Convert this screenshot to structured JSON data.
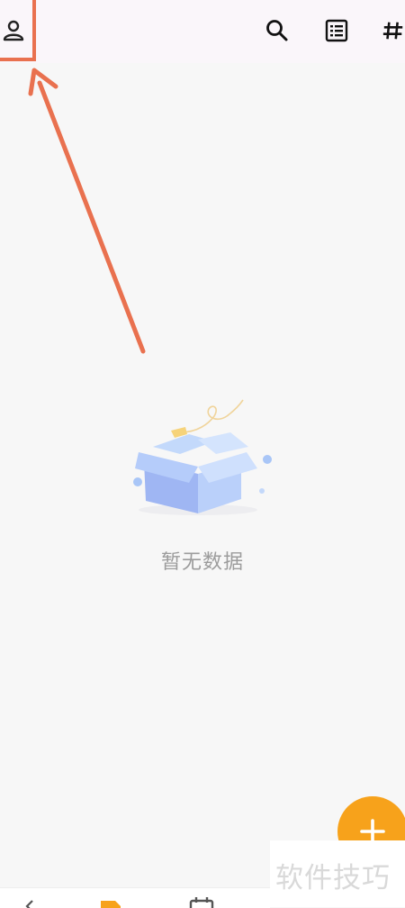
{
  "header": {
    "icons": [
      "profile-icon",
      "search-icon",
      "list-icon",
      "hashtag-icon"
    ]
  },
  "empty_state": {
    "message": "暂无数据"
  },
  "fab": {
    "symbol": "+",
    "color": "#f7a21b"
  },
  "watermark": {
    "text": "软件技巧"
  },
  "annotation": {
    "color": "#e9714f"
  },
  "bottom_nav": {
    "icons": [
      "back-icon",
      "notes-icon",
      "calendar-icon"
    ],
    "active_color": "#f7a21b"
  }
}
